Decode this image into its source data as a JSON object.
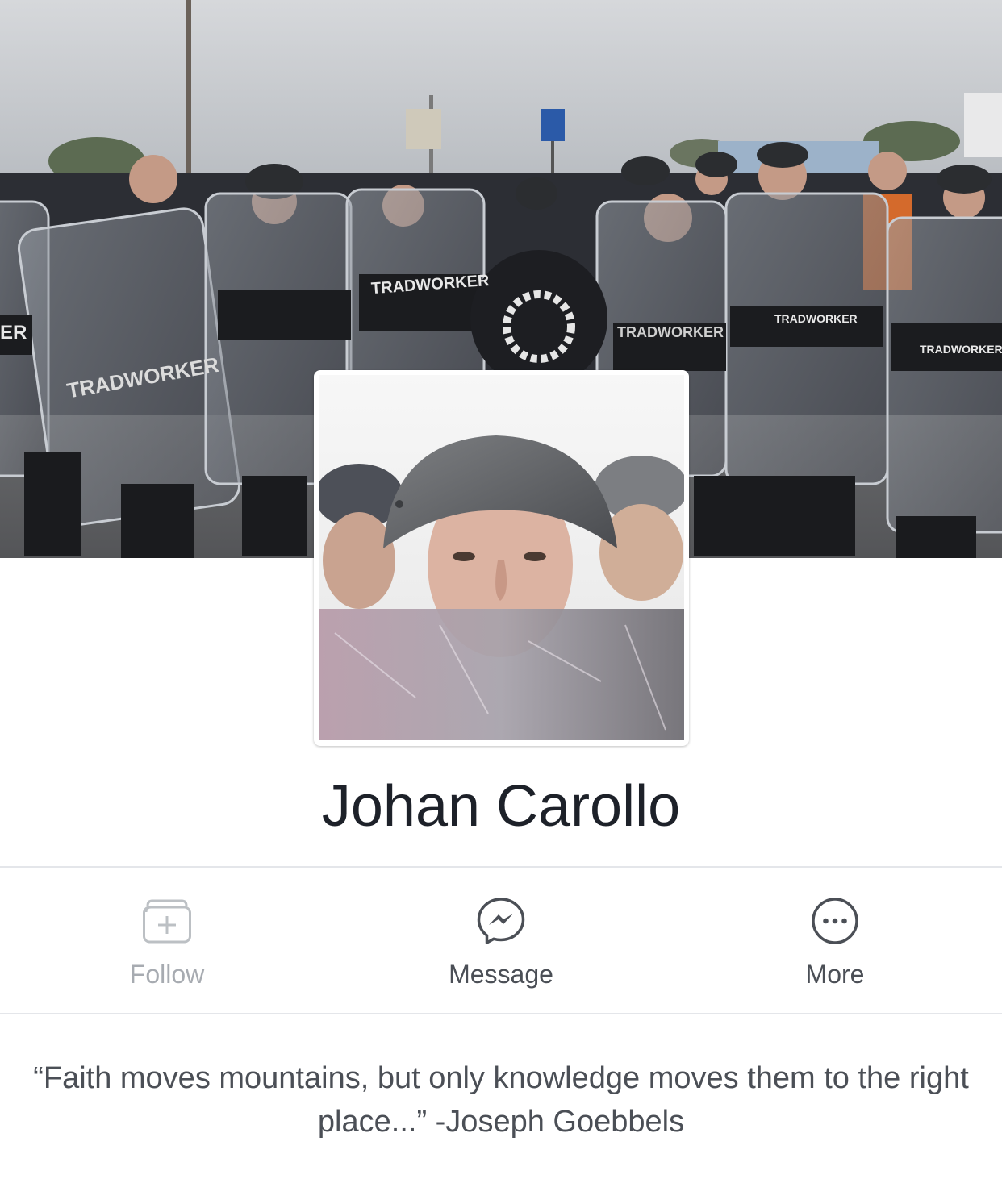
{
  "profile": {
    "name": "Johan Carollo",
    "bio": "“Faith moves mountains, but only knowledge moves them to the right place...” -Joseph Goebbels"
  },
  "actions": [
    {
      "label": "Follow",
      "icon": "follow-icon",
      "enabled": false
    },
    {
      "label": "Message",
      "icon": "messenger-icon",
      "enabled": true
    },
    {
      "label": "More",
      "icon": "more-icon",
      "enabled": true
    }
  ],
  "cover_photo": {
    "description_icon": "cover-photo",
    "shield_text": [
      "TRADWORKER",
      "TRADWORKER",
      "TRADWORKER",
      "TRADWORKER",
      "TRADWORKER"
    ]
  },
  "colors": {
    "name": "#1d2129",
    "label": "#4b4f56",
    "label_disabled": "#a7abb1",
    "divider": "#e4e6ea"
  }
}
